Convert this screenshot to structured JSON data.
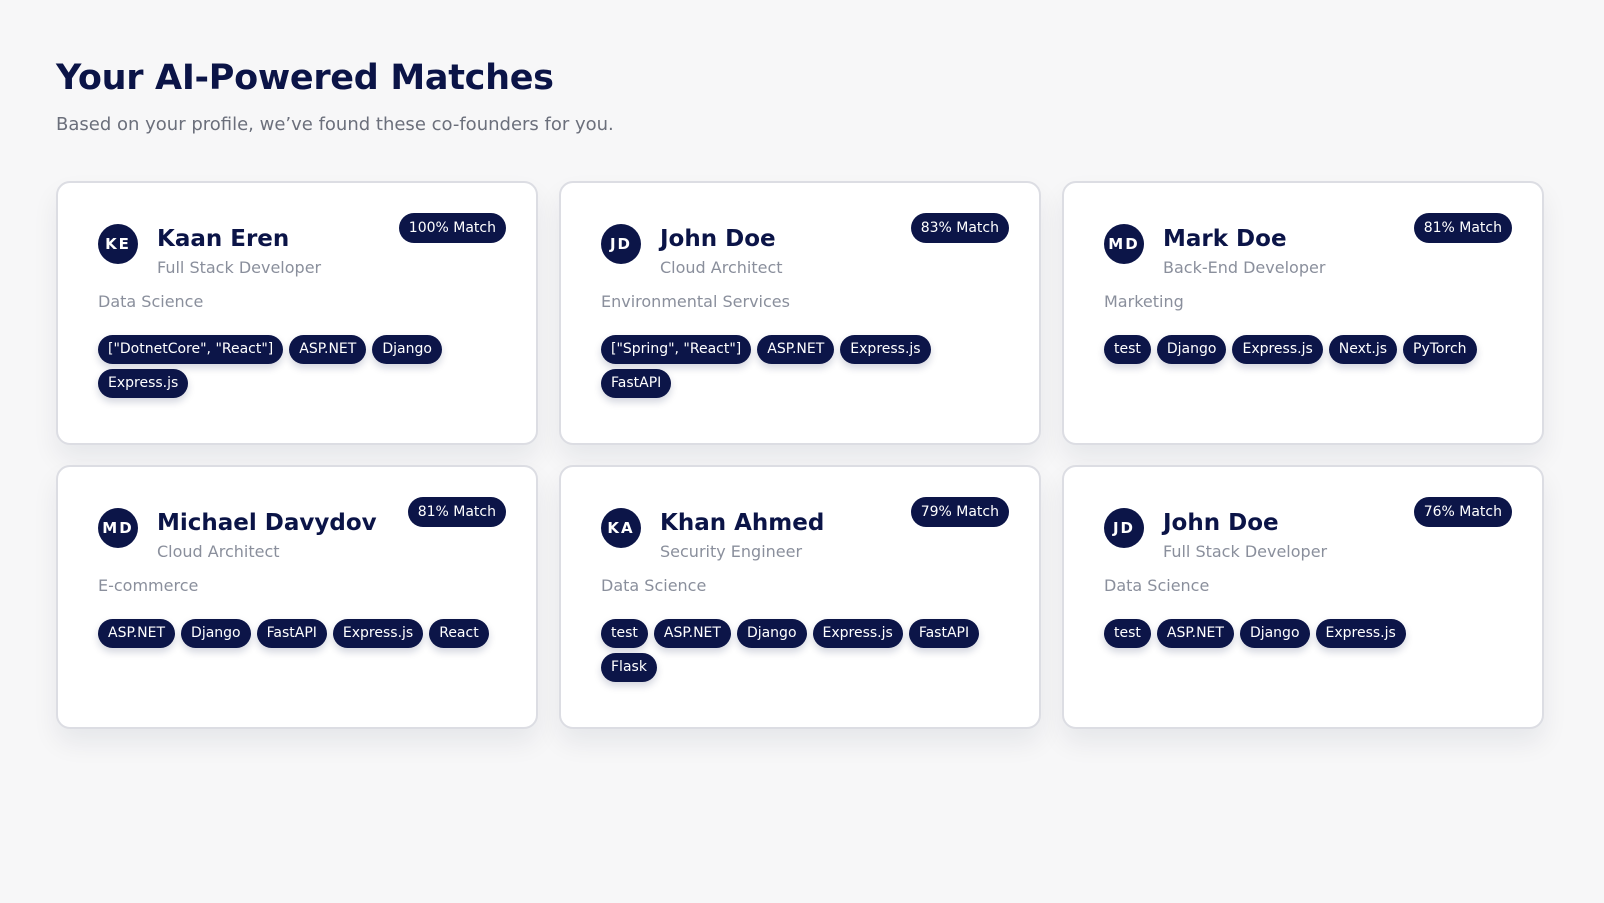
{
  "header": {
    "title": "Your AI-Powered Matches",
    "subtitle": "Based on your profile, we’ve found these co-founders for you."
  },
  "matches": [
    {
      "initials": "KE",
      "name": "Kaan Eren",
      "role": "Full Stack Developer",
      "industry": "Data Science",
      "match": "100% Match",
      "match_percent": 100,
      "skills": [
        "[\"DotnetCore\", \"React\"]",
        "ASP.NET",
        "Django",
        "Express.js"
      ]
    },
    {
      "initials": "JD",
      "name": "John Doe",
      "role": "Cloud Architect",
      "industry": "Environmental Services",
      "match": "83% Match",
      "match_percent": 83,
      "skills": [
        "[\"Spring\", \"React\"]",
        "ASP.NET",
        "Express.js",
        "FastAPI"
      ]
    },
    {
      "initials": "MD",
      "name": "Mark Doe",
      "role": "Back-End Developer",
      "industry": "Marketing",
      "match": "81% Match",
      "match_percent": 81,
      "skills": [
        "test",
        "Django",
        "Express.js",
        "Next.js",
        "PyTorch"
      ]
    },
    {
      "initials": "MD",
      "name": "Michael Davydov",
      "role": "Cloud Architect",
      "industry": "E-commerce",
      "match": "81% Match",
      "match_percent": 81,
      "skills": [
        "ASP.NET",
        "Django",
        "FastAPI",
        "Express.js",
        "React"
      ]
    },
    {
      "initials": "KA",
      "name": "Khan Ahmed",
      "role": "Security Engineer",
      "industry": "Data Science",
      "match": "79% Match",
      "match_percent": 79,
      "skills": [
        "test",
        "ASP.NET",
        "Django",
        "Express.js",
        "FastAPI",
        "Flask"
      ]
    },
    {
      "initials": "JD",
      "name": "John Doe",
      "role": "Full Stack Developer",
      "industry": "Data Science",
      "match": "76% Match",
      "match_percent": 76,
      "skills": [
        "test",
        "ASP.NET",
        "Django",
        "Express.js"
      ]
    }
  ]
}
